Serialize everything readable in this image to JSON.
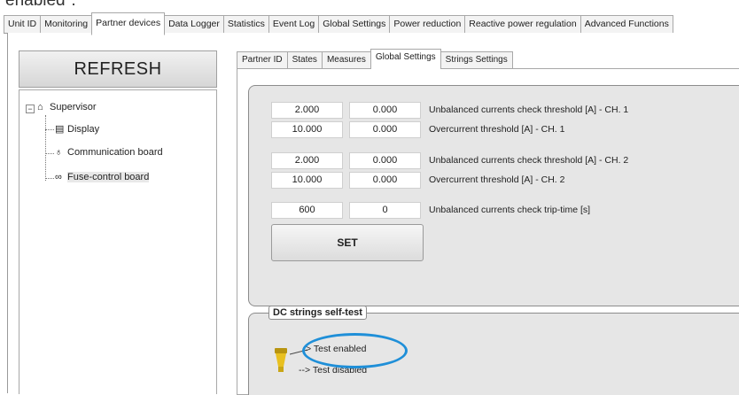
{
  "fragment_text": "enabled\".",
  "top_tabs": [
    "Unit ID",
    "Monitoring",
    "Partner devices",
    "Data Logger",
    "Statistics",
    "Event Log",
    "Global Settings",
    "Power reduction",
    "Reactive power regulation",
    "Advanced Functions"
  ],
  "top_tab_active": "Partner devices",
  "refresh_label": "REFRESH",
  "tree": {
    "root": "Supervisor",
    "children": [
      "Display",
      "Communication board",
      "Fuse-control board"
    ],
    "selected": "Fuse-control board"
  },
  "sub_tabs": [
    "Partner ID",
    "States",
    "Measures",
    "Global Settings",
    "Strings Settings"
  ],
  "sub_tab_active": "Global Settings",
  "settings": [
    {
      "value1": "2.000",
      "value2": "0.000",
      "label": "Unbalanced currents check threshold [A] - CH. 1"
    },
    {
      "value1": "10.000",
      "value2": "0.000",
      "label": "Overcurrent threshold [A] - CH. 1"
    },
    {
      "value1": "2.000",
      "value2": "0.000",
      "label": "Unbalanced currents check threshold [A] - CH. 2"
    },
    {
      "value1": "10.000",
      "value2": "0.000",
      "label": "Overcurrent threshold [A] - CH. 2"
    },
    {
      "value1": "600",
      "value2": "0",
      "label": "Unbalanced currents check trip-time [s]"
    }
  ],
  "set_label": "SET",
  "selftest": {
    "title": "DC strings self-test",
    "opt_enabled": "Test enabled",
    "opt_disabled": "--> Test disabled",
    "lamp_color": "#e8c020",
    "highlight_color": "#1f8fd8"
  }
}
